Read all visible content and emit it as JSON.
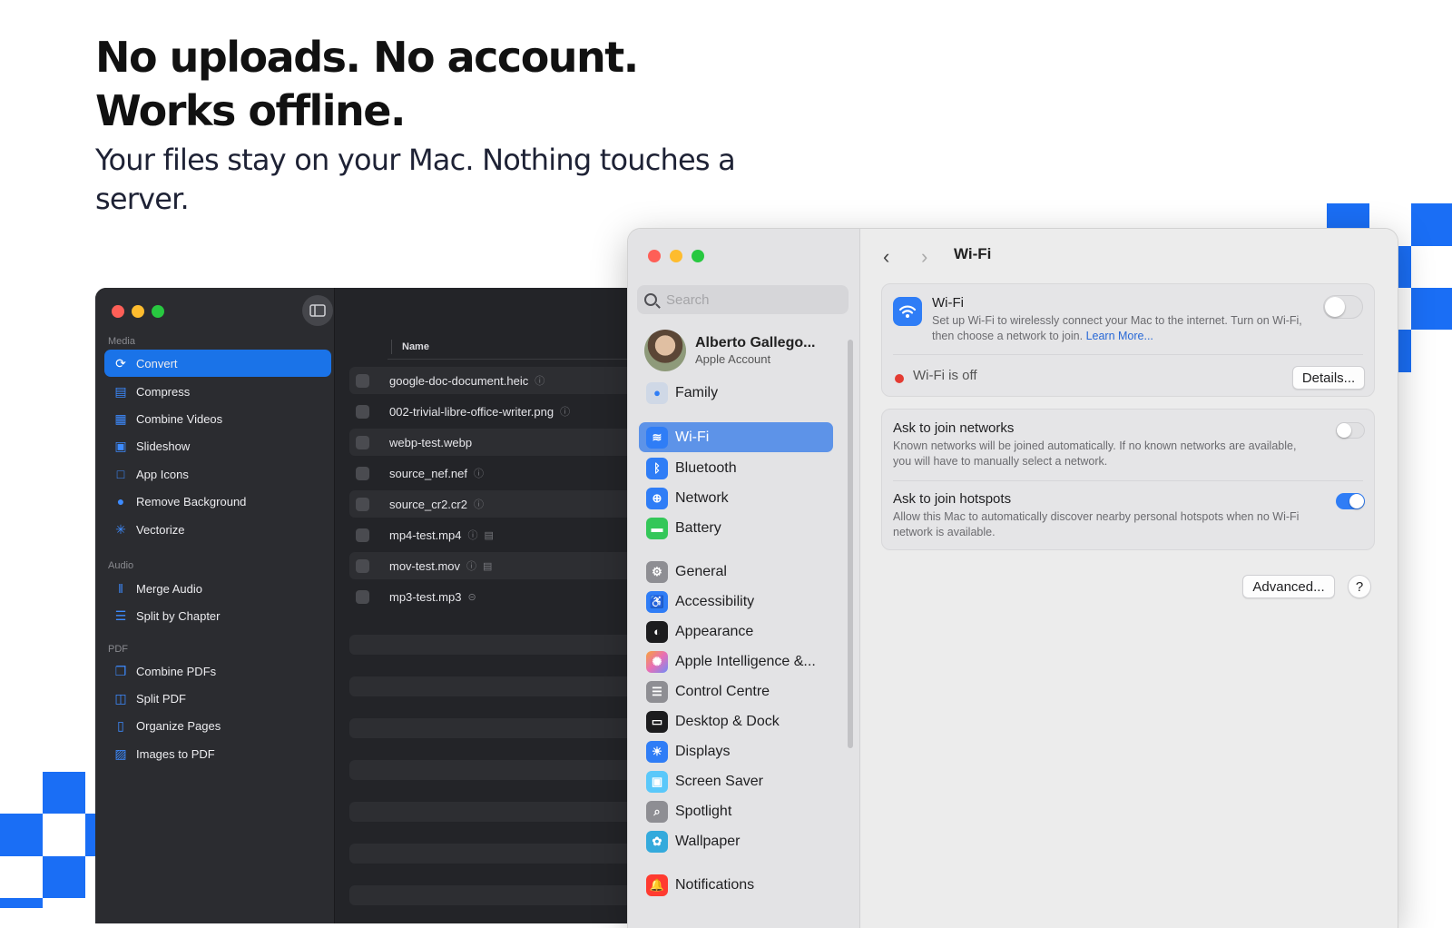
{
  "hero": {
    "headline_line1": "No uploads. No account.",
    "headline_line2": "Works offline.",
    "subhead": "Your files stay on your Mac. Nothing touches a server."
  },
  "colors": {
    "accent": "#1a6ef5",
    "selection": "#1a73e8",
    "settings_selection": "#5d93e8"
  },
  "app": {
    "sections": [
      {
        "label": "Media",
        "items": [
          {
            "label": "Convert",
            "icon": "convert-icon",
            "selected": true
          },
          {
            "label": "Compress",
            "icon": "compress-icon"
          },
          {
            "label": "Combine Videos",
            "icon": "combine-videos-icon"
          },
          {
            "label": "Slideshow",
            "icon": "slideshow-icon"
          },
          {
            "label": "App Icons",
            "icon": "app-icons-icon"
          },
          {
            "label": "Remove Background",
            "icon": "remove-background-icon"
          },
          {
            "label": "Vectorize",
            "icon": "vectorize-icon"
          }
        ]
      },
      {
        "label": "Audio",
        "items": [
          {
            "label": "Merge Audio",
            "icon": "merge-audio-icon"
          },
          {
            "label": "Split by Chapter",
            "icon": "split-by-chapter-icon"
          }
        ]
      },
      {
        "label": "PDF",
        "items": [
          {
            "label": "Combine PDFs",
            "icon": "combine-pdfs-icon"
          },
          {
            "label": "Split PDF",
            "icon": "split-pdf-icon"
          },
          {
            "label": "Organize Pages",
            "icon": "organize-pages-icon"
          },
          {
            "label": "Images to PDF",
            "icon": "images-to-pdf-icon"
          }
        ]
      }
    ],
    "column_name": "Name",
    "files": [
      {
        "name": "google-doc-document.heic",
        "badges": [
          "info"
        ]
      },
      {
        "name": "002-trivial-libre-office-writer.png",
        "badges": [
          "info"
        ]
      },
      {
        "name": "webp-test.webp",
        "badges": []
      },
      {
        "name": "source_nef.nef",
        "badges": [
          "info"
        ]
      },
      {
        "name": "source_cr2.cr2",
        "badges": [
          "info"
        ]
      },
      {
        "name": "mp4-test.mp4",
        "badges": [
          "info",
          "film"
        ]
      },
      {
        "name": "mov-test.mov",
        "badges": [
          "info",
          "film"
        ]
      },
      {
        "name": "mp3-test.mp3",
        "badges": [
          "audio"
        ]
      }
    ]
  },
  "settings": {
    "search_placeholder": "Search",
    "account": {
      "name": "Alberto Gallego...",
      "sub": "Apple Account"
    },
    "family": "Family",
    "groups": [
      [
        {
          "label": "Wi-Fi",
          "icon": "wifi-icon",
          "color": "#2f7df6",
          "selected": true
        },
        {
          "label": "Bluetooth",
          "icon": "bluetooth-icon",
          "color": "#2f7df6"
        },
        {
          "label": "Network",
          "icon": "network-icon",
          "color": "#2f7df6"
        },
        {
          "label": "Battery",
          "icon": "battery-icon",
          "color": "#34c759"
        }
      ],
      [
        {
          "label": "General",
          "icon": "gear-icon",
          "color": "#8e8e93"
        },
        {
          "label": "Accessibility",
          "icon": "accessibility-icon",
          "color": "#2f7df6"
        },
        {
          "label": "Appearance",
          "icon": "appearance-icon",
          "color": "#1c1c1e"
        },
        {
          "label": "Apple Intelligence &...",
          "icon": "apple-intelligence-icon",
          "color": "#e86fb6"
        },
        {
          "label": "Control Centre",
          "icon": "control-centre-icon",
          "color": "#8e8e93"
        },
        {
          "label": "Desktop & Dock",
          "icon": "desktop-dock-icon",
          "color": "#1c1c1e"
        },
        {
          "label": "Displays",
          "icon": "displays-icon",
          "color": "#2f7df6"
        },
        {
          "label": "Screen Saver",
          "icon": "screen-saver-icon",
          "color": "#5ac8fa"
        },
        {
          "label": "Spotlight",
          "icon": "spotlight-icon",
          "color": "#8e8e93"
        },
        {
          "label": "Wallpaper",
          "icon": "wallpaper-icon",
          "color": "#34aadc"
        }
      ],
      [
        {
          "label": "Notifications",
          "icon": "notifications-icon",
          "color": "#ff3b30"
        }
      ]
    ],
    "page_title": "Wi-Fi",
    "wifi": {
      "title": "Wi-Fi",
      "desc": "Set up Wi-Fi to wirelessly connect your Mac to the internet. Turn on Wi-Fi, then choose a network to join.",
      "link": "Learn More...",
      "status": "Wi-Fi is off",
      "details_button": "Details..."
    },
    "ask_networks": {
      "title": "Ask to join networks",
      "desc": "Known networks will be joined automatically. If no known networks are available, you will have to manually select a network."
    },
    "ask_hotspots": {
      "title": "Ask to join hotspots",
      "desc": "Allow this Mac to automatically discover nearby personal hotspots when no Wi-Fi network is available."
    },
    "advanced_button": "Advanced...",
    "help_button": "?"
  }
}
